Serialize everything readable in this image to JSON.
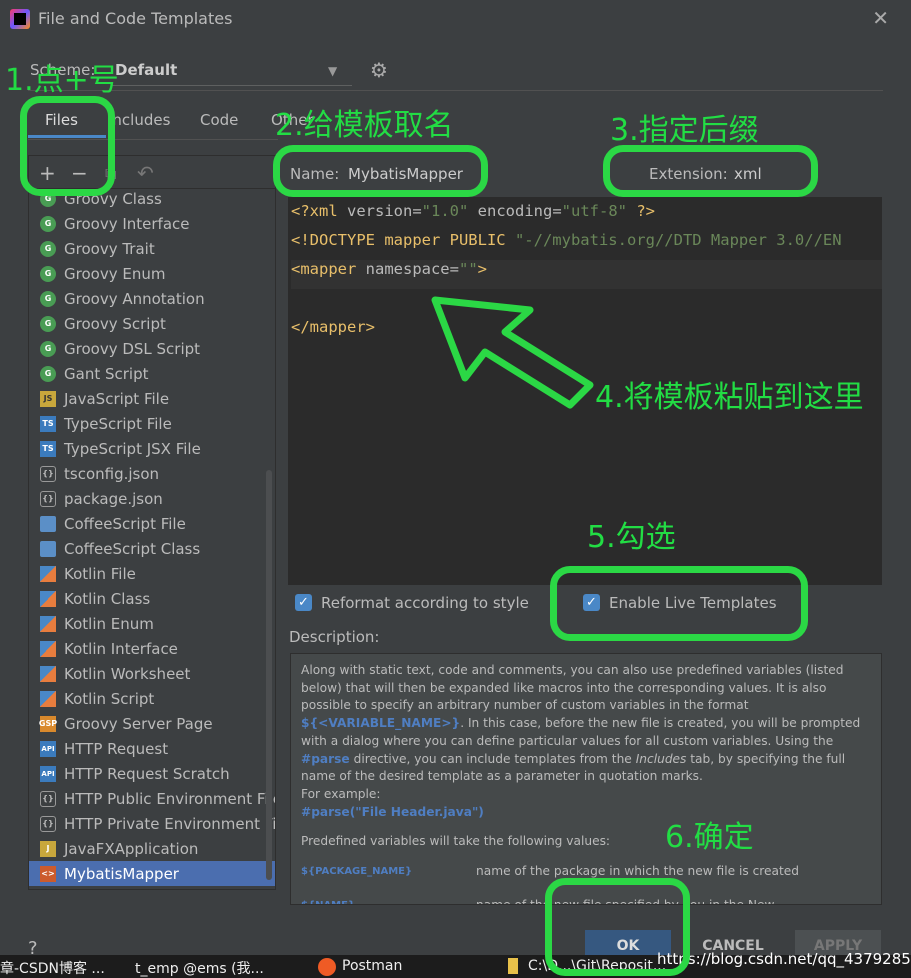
{
  "window": {
    "title": "File and Code Templates",
    "close": "✕"
  },
  "scheme": {
    "label": "Scheme:",
    "value": "Default"
  },
  "tabs": [
    "Files",
    "Includes",
    "Code",
    "Other"
  ],
  "toolbar": {
    "add": "+",
    "remove": "−",
    "copy": "⧉",
    "reset": "↶"
  },
  "files": [
    {
      "label": "Groovy Class",
      "icon": "groovy"
    },
    {
      "label": "Groovy Interface",
      "icon": "groovy"
    },
    {
      "label": "Groovy Trait",
      "icon": "groovy"
    },
    {
      "label": "Groovy Enum",
      "icon": "groovy"
    },
    {
      "label": "Groovy Annotation",
      "icon": "groovy"
    },
    {
      "label": "Groovy Script",
      "icon": "groovy"
    },
    {
      "label": "Groovy DSL Script",
      "icon": "groovy"
    },
    {
      "label": "Gant Script",
      "icon": "groovy"
    },
    {
      "label": "JavaScript File",
      "icon": "js"
    },
    {
      "label": "TypeScript File",
      "icon": "ts"
    },
    {
      "label": "TypeScript JSX File",
      "icon": "ts"
    },
    {
      "label": "tsconfig.json",
      "icon": "json"
    },
    {
      "label": "package.json",
      "icon": "json"
    },
    {
      "label": "CoffeeScript File",
      "icon": "coffee"
    },
    {
      "label": "CoffeeScript Class",
      "icon": "coffee"
    },
    {
      "label": "Kotlin File",
      "icon": "kotlin"
    },
    {
      "label": "Kotlin Class",
      "icon": "kotlin"
    },
    {
      "label": "Kotlin Enum",
      "icon": "kotlin"
    },
    {
      "label": "Kotlin Interface",
      "icon": "kotlin"
    },
    {
      "label": "Kotlin Worksheet",
      "icon": "kotlin"
    },
    {
      "label": "Kotlin Script",
      "icon": "kotlin"
    },
    {
      "label": "Groovy Server Page",
      "icon": "gsp"
    },
    {
      "label": "HTTP Request",
      "icon": "api"
    },
    {
      "label": "HTTP Request Scratch",
      "icon": "api"
    },
    {
      "label": "HTTP Public Environment File",
      "icon": "json"
    },
    {
      "label": "HTTP Private Environment File",
      "icon": "json"
    },
    {
      "label": "JavaFXApplication",
      "icon": "jfx"
    },
    {
      "label": "MybatisMapper",
      "icon": "xml",
      "selected": true
    }
  ],
  "template": {
    "name_label": "Name:",
    "name": "MybatisMapper",
    "ext_label": "Extension:",
    "ext": "xml"
  },
  "code": {
    "l1": [
      "<?xml ",
      "version=",
      "\"1.0\"",
      " encoding=",
      "\"utf-8\"",
      " ?>"
    ],
    "l2": [
      "<!DOCTYPE mapper PUBLIC ",
      "\"-//mybatis.org//DTD Mapper 3.0//EN"
    ],
    "l3": [
      "<mapper ",
      "namespace=",
      "\"\"",
      ">"
    ],
    "l5": "</mapper>"
  },
  "options": {
    "reformat": "Reformat according to style",
    "reformat_checked": true,
    "live": "Enable Live Templates",
    "live_checked": true
  },
  "description": {
    "label": "Description:",
    "p1": "Along with static text, code and comments, you can also use predefined variables (listed below) that will then be expanded like macros into the corresponding values. It is also possible to specify an arbitrary number of custom variables in the format ",
    "var1": "${<VARIABLE_NAME>}",
    "p2": ". In this case, before the new file is created, you will be prompted with a dialog where you can define particular values for all custom variables. Using the ",
    "var2": "#parse",
    "p3": " directive, you can include templates from the ",
    "includes": "Includes",
    "p4": " tab, by specifying the full name of the desired template as a parameter in quotation marks.",
    "example": "For example:",
    "example_code": "#parse(\"File Header.java\")",
    "predef": "Predefined variables will take the following values:",
    "vars": [
      {
        "name": "${PACKAGE_NAME}",
        "desc": "name of the package in which the new file is created"
      },
      {
        "name": "${NAME}",
        "desc": "name of the new file specified by you in the New"
      }
    ]
  },
  "buttons": {
    "help": "?",
    "ok": "OK",
    "cancel": "CANCEL",
    "apply": "APPLY"
  },
  "taskbar": [
    "章-CSDN博客 ...",
    "t_emp @ems (我...",
    "Postman",
    "C:\\D...\\Git\\Reposit...",
    "..."
  ],
  "watermark": "https://blog.csdn.net/qq_43792852",
  "annotations": [
    "1.点+号",
    "2.给模板取名",
    "3.指定后缀",
    "4.将模板粘贴到这里",
    "5.勾选",
    "6.确定"
  ],
  "colors": {
    "accent": "#4a88c7",
    "annotation": "#2bd845",
    "selection": "#4b6eaf"
  }
}
